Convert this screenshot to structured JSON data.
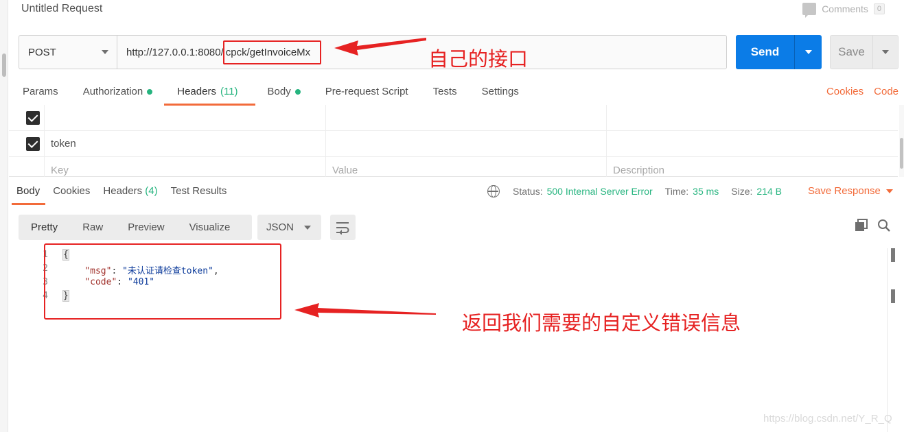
{
  "request": {
    "title": "Untitled Request",
    "comments_label": "Comments",
    "comments_count": "0",
    "method": "POST",
    "url_base": "http://127.0.0.1:8080/",
    "url_path": "cpck/getInvoiceMx",
    "send_label": "Send",
    "save_label": "Save"
  },
  "request_tabs": {
    "params": "Params",
    "authorization": "Authorization",
    "headers": "Headers",
    "headers_count": "(11)",
    "body": "Body",
    "prerequest": "Pre-request Script",
    "tests": "Tests",
    "settings": "Settings",
    "cookies": "Cookies",
    "code": "Code"
  },
  "headers_table": {
    "row2_key": "token",
    "placeholder_key": "Key",
    "placeholder_value": "Value",
    "placeholder_description": "Description"
  },
  "response_tabs": {
    "body": "Body",
    "cookies": "Cookies",
    "headers": "Headers",
    "headers_count": "(4)",
    "test_results": "Test Results"
  },
  "response_status": {
    "status_label": "Status:",
    "status_value": "500 Internal Server Error",
    "time_label": "Time:",
    "time_value": "35 ms",
    "size_label": "Size:",
    "size_value": "214 B",
    "save_response": "Save Response"
  },
  "response_view": {
    "pretty": "Pretty",
    "raw": "Raw",
    "preview": "Preview",
    "visualize": "Visualize",
    "format": "JSON"
  },
  "response_body": {
    "line_numbers": [
      "1",
      "2",
      "3",
      "4"
    ],
    "open_brace": "{",
    "msg_key": "\"msg\"",
    "msg_value": "\"未认证请检查token\"",
    "code_key": "\"code\"",
    "code_value": "\"401\"",
    "close_brace": "}"
  },
  "annotations": {
    "interface_note": "自己的接口",
    "error_note": "返回我们需要的自定义错误信息",
    "color": "#e62222"
  },
  "watermark": "https://blog.csdn.net/Y_R_Q",
  "colors": {
    "accent": "#f26b3a",
    "send": "#0b7ce7",
    "success": "#26b47f"
  }
}
